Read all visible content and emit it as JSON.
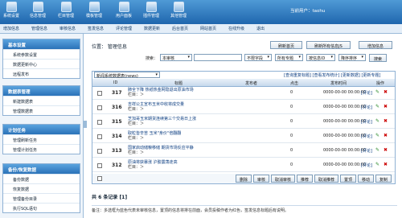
{
  "toolbar": [
    {
      "label": "系统设置"
    },
    {
      "label": "信息管理"
    },
    {
      "label": "栏目管理"
    },
    {
      "label": "模板管理"
    },
    {
      "label": "用户面板"
    },
    {
      "label": "插件管理"
    },
    {
      "label": "其他管理"
    }
  ],
  "user": {
    "label": "当前用户：",
    "name": "taohu"
  },
  "subnav": [
    "增加信息",
    "管理信息",
    "审核信息",
    "签发信息",
    "评论管理",
    "数据更新",
    "后台首页",
    "网站首页",
    "在线升级",
    "退出"
  ],
  "sidebar": [
    {
      "title": "基本设置",
      "items": [
        "系统参数设置",
        "数据更新中心",
        "远程发布"
      ]
    },
    {
      "title": "数据表管理",
      "items": [
        "新建数据表",
        "管理数据表"
      ]
    },
    {
      "title": "计划任务",
      "items": [
        "管理刷新任务",
        "管理计划任务"
      ]
    },
    {
      "title": "备份/恢复数据",
      "items": [
        "备份数据",
        "恢复数据",
        "管理备份目录",
        "执行SQL语句"
      ]
    }
  ],
  "main": {
    "location": "位置： 管理信息",
    "buttons": {
      "refresh": "刷新首页",
      "refresh_all": "刷新所有信息JS",
      "add": "增加信息"
    },
    "search": {
      "label": "搜索：",
      "type": "本审核",
      "field_placeholder": "",
      "scope": "不限字段",
      "sort_scope": "所有专题",
      "sort_field": "按信息ID",
      "order": "降序排序",
      "go": "搜索"
    },
    "table_select": "新闻系统数据表(news)",
    "links": "[查询重复标题] [查看发布统计] [更新数据] [更新专题]",
    "columns": {
      "id": "ID",
      "title": "标题",
      "publisher": "发布者",
      "clicks": "点击",
      "time": "发布时间",
      "ops": "操作"
    },
    "rows": [
      {
        "id": "317",
        "title": "肺全下降 热纸热金网隐退出原油市场",
        "cat": "栏目：＞",
        "clicks": "0",
        "time": "0000-00-00 00:00:00",
        "op": "[评论]"
      },
      {
        "id": "316",
        "title": "吉祥公主宣布玉米中收将成交量",
        "cat": "栏目：＞",
        "clicks": "0",
        "time": "0000-00-00 00:00:00",
        "op": "[评论]"
      },
      {
        "id": "315",
        "title": "芝加哥玉米期货连续第三个交易日上涨",
        "cat": "栏目：＞",
        "clicks": "0",
        "time": "0000-00-00 00:00:00",
        "op": "[评论]"
      },
      {
        "id": "314",
        "title": "取粒皆辛苦 玉米\"身价\"倍翻翻",
        "cat": "栏目：＞",
        "clicks": "0",
        "time": "0000-00-00 00:00:00",
        "op": "[评论]"
      },
      {
        "id": "313",
        "title": "国家启动储粮移储 期货市场反应平静",
        "cat": "栏目：＞",
        "clicks": "0",
        "time": "0000-00-00 00:00:00",
        "op": "[评论]"
      },
      {
        "id": "312",
        "title": "原油将获暴涨 沪胶震荡走高",
        "cat": "栏目：＞",
        "clicks": "0",
        "time": "0000-00-00 00:00:00",
        "op": "[评论]"
      }
    ],
    "bottom_buttons": [
      "删除",
      "审核",
      "取消审核",
      "推荐",
      "取消推荐",
      "置顶",
      "移动",
      "复制"
    ],
    "total": "共 6 条记录   [1]",
    "note": "备注：多选框为蓝色代表未审核信息，置顶的信息将排在前面，会员投稿作者为红色，签发信息标题后有说明。"
  }
}
